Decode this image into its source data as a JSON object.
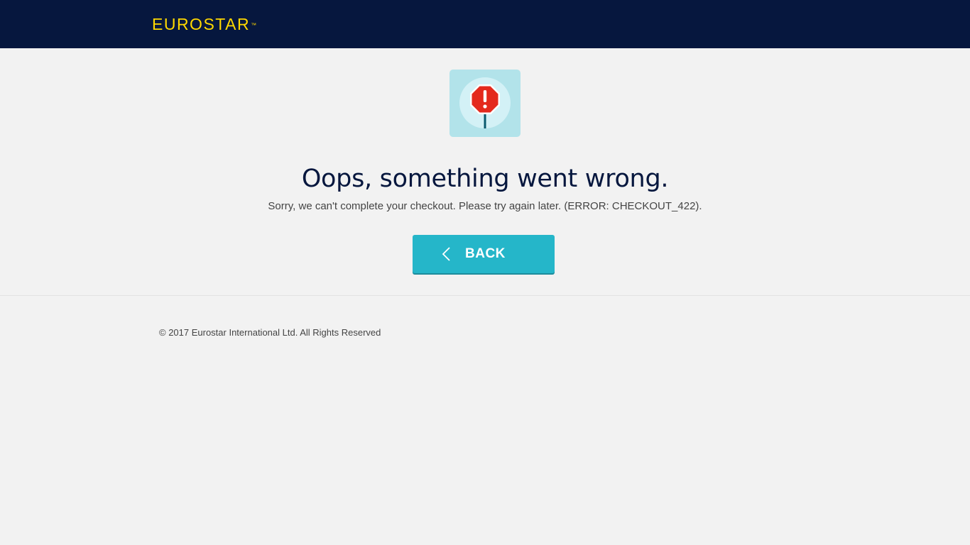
{
  "header": {
    "logo_text": "EUROSTAR",
    "logo_mark": "™",
    "background_color": "#06173e",
    "logo_color": "#ffd800"
  },
  "error": {
    "icon": "stop-sign-warning-icon",
    "title": "Oops, something went wrong.",
    "message": "Sorry, we can't complete your checkout. Please try again later. (ERROR: CHECKOUT_422)."
  },
  "actions": {
    "back_label": "BACK",
    "back_icon": "chevron-left-icon",
    "button_color": "#25b6c9"
  },
  "footer": {
    "copyright": "© 2017 Eurostar International Ltd. All Rights Reserved"
  }
}
